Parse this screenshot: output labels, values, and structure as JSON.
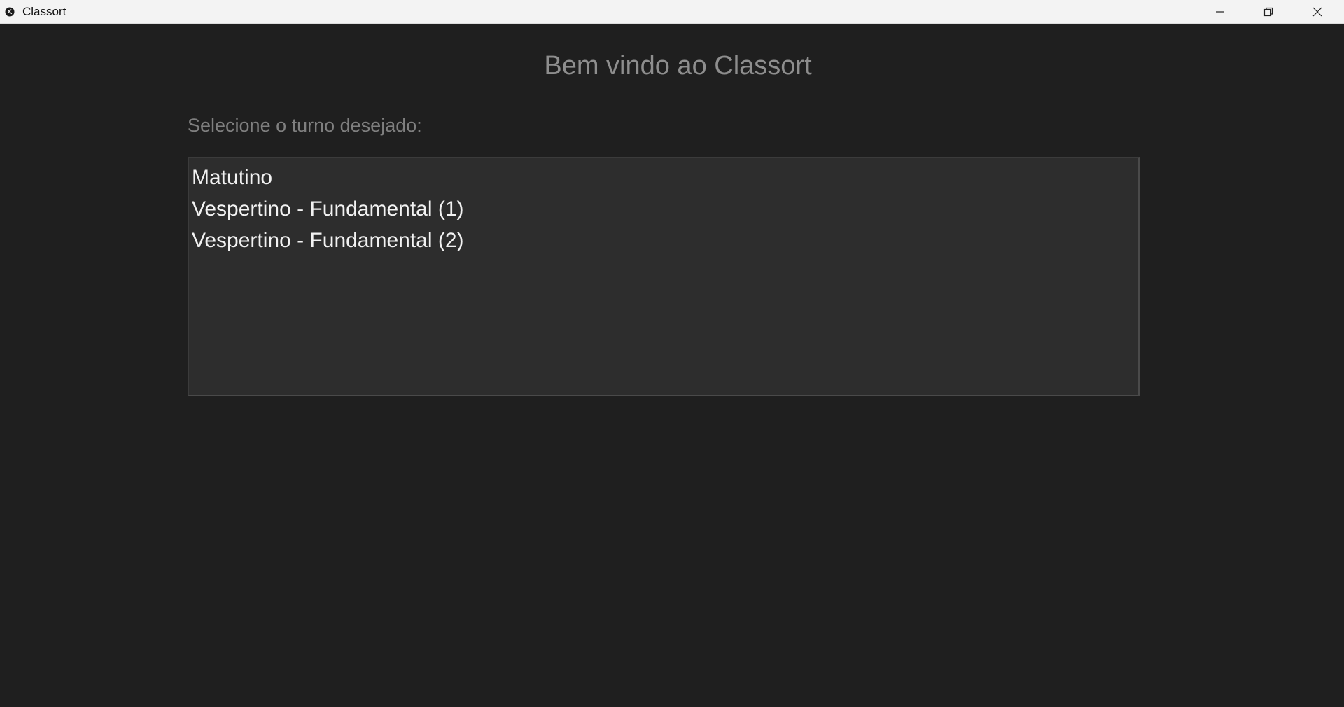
{
  "window": {
    "title": "Classort",
    "controls": {
      "minimize": "minimize-icon",
      "maximize": "restore-icon",
      "close": "close-icon"
    }
  },
  "main": {
    "welcome": "Bem vindo ao Classort",
    "prompt": "Selecione o turno desejado:",
    "shifts": [
      "Matutino",
      "Vespertino - Fundamental (1)",
      "Vespertino - Fundamental (2)"
    ]
  },
  "colors": {
    "background": "#1f1f1f",
    "listbox_background": "#2d2d2d",
    "item_text": "#f2f2f2",
    "muted_text": "#8e8e8e",
    "titlebar": "#f3f3f3"
  }
}
